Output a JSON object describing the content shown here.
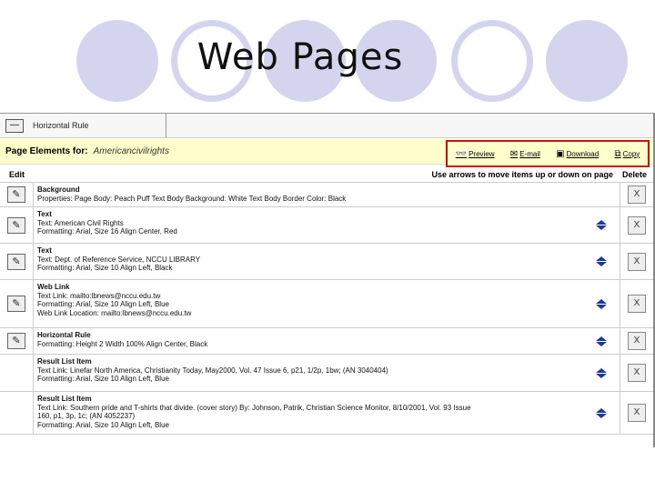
{
  "slide": {
    "title": "Web Pages"
  },
  "toolbar": {
    "horizontal_rule_label": "Horizontal Rule",
    "hr_icon": "horizontal-rule-icon"
  },
  "page_elements": {
    "label": "Page Elements for:",
    "name": "Americancivilrights"
  },
  "tools": [
    {
      "label": "Preview",
      "icon": "glasses-icon"
    },
    {
      "label": "E-mail",
      "icon": "envelope-icon"
    },
    {
      "label": "Download",
      "icon": "floppy-icon"
    },
    {
      "label": "Copy",
      "icon": "copy-icon"
    }
  ],
  "table": {
    "headers": {
      "edit": "Edit",
      "move": "Use arrows to move items up or down on page",
      "delete": "Delete"
    },
    "rows": [
      {
        "title": "Background",
        "lines": [
          "Properties: Page Body: Peach Puff Text Body Background: White Text Body Border Color: Black"
        ],
        "editable": true,
        "movable": false
      },
      {
        "title": "Text",
        "lines": [
          "Text: American Civil Rights",
          "Formatting: Arial, Size 16 Align Center, Red"
        ],
        "editable": true,
        "movable": true
      },
      {
        "title": "Text",
        "lines": [
          "Text: Dept. of Reference Service, NCCU LIBRARY",
          "Formatting: Arial, Size 10 Align Left, Black"
        ],
        "editable": true,
        "movable": true
      },
      {
        "title": "Web Link",
        "lines": [
          "Text Link: mailto:lbnews@nccu.edu.tw",
          "Formatting: Arial, Size 10 Align Left, Blue",
          "Web Link Location: mailto:lbnews@nccu.edu.tw"
        ],
        "editable": true,
        "movable": true
      },
      {
        "title": "Horizontal Rule",
        "lines": [
          "Formatting: Height 2 Width 100% Align Center, Black"
        ],
        "editable": true,
        "movable": true
      },
      {
        "title": "Result List Item",
        "lines": [
          "Text Link: Linefar North America, Christianity Today, May2000, Vol. 47 Issue 6, p21, 1/2p, 1bw; (AN 3040404)",
          "Formatting: Arial, Size 10 Align Left, Blue"
        ],
        "editable": false,
        "movable": true
      },
      {
        "title": "Result List Item",
        "lines": [
          "Text Link: Southern pride and T-shirts that divide. (cover story) By: Johnson, Patrik, Christian Science Monitor, 8/10/2001, Vol. 93 Issue",
          "160, p1, 3p, 1c; (AN 4052237)",
          "Formatting: Arial, Size 10 Align Left, Blue"
        ],
        "editable": false,
        "movable": true
      }
    ]
  },
  "colors": {
    "accent_circle": "#d4d4ee",
    "highlight_bar": "#ffffcc",
    "callout_border": "#cc1111",
    "arrow": "#1f3a93"
  }
}
